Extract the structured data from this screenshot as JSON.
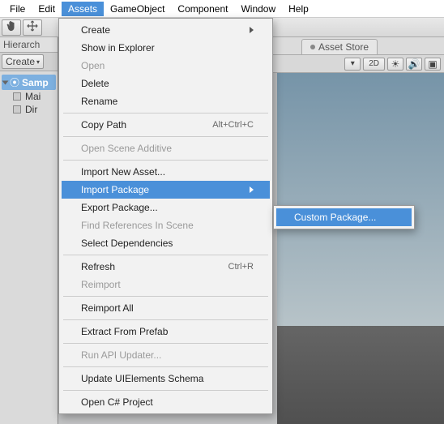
{
  "menubar": {
    "items": [
      "File",
      "Edit",
      "Assets",
      "GameObject",
      "Component",
      "Window",
      "Help"
    ],
    "active_index": 2
  },
  "hierarchy": {
    "title": "Hierarch",
    "create": "Create",
    "root": "Samp",
    "child1": "Mai",
    "child2": "Dir"
  },
  "scene": {
    "tab_asset_store": "Asset Store",
    "controls": {
      "mode": "2D"
    }
  },
  "assets_menu": {
    "create": "Create",
    "show_in_explorer": "Show in Explorer",
    "open": "Open",
    "delete": "Delete",
    "rename": "Rename",
    "copy_path": "Copy Path",
    "copy_path_shortcut": "Alt+Ctrl+C",
    "open_scene_additive": "Open Scene Additive",
    "import_new_asset": "Import New Asset...",
    "import_package": "Import Package",
    "export_package": "Export Package...",
    "find_references": "Find References In Scene",
    "select_dependencies": "Select Dependencies",
    "refresh": "Refresh",
    "refresh_shortcut": "Ctrl+R",
    "reimport": "Reimport",
    "reimport_all": "Reimport All",
    "extract_from_prefab": "Extract From Prefab",
    "run_api_updater": "Run API Updater...",
    "update_uielements": "Update UIElements Schema",
    "open_csharp": "Open C# Project"
  },
  "import_package_submenu": {
    "custom_package": "Custom Package..."
  }
}
